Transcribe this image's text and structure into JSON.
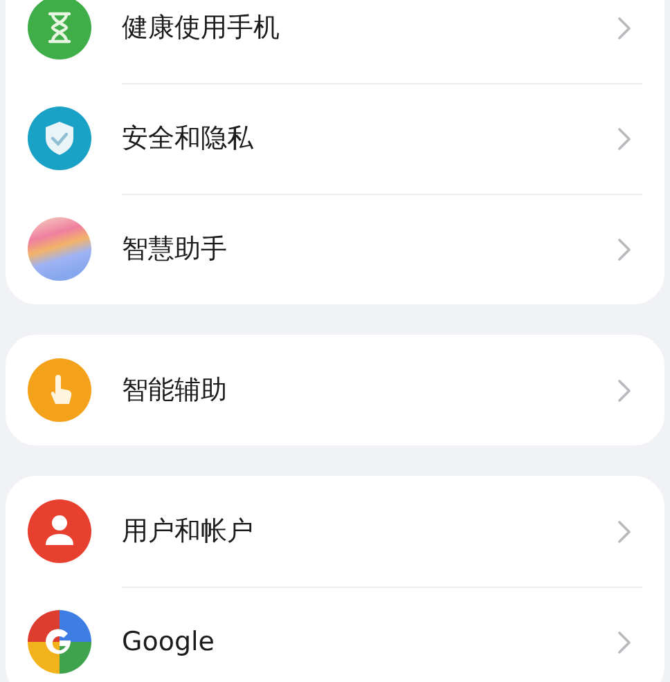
{
  "groups": [
    {
      "items": [
        {
          "label": "健康使用手机"
        },
        {
          "label": "安全和隐私"
        },
        {
          "label": "智慧助手"
        }
      ]
    },
    {
      "items": [
        {
          "label": "智能辅助"
        }
      ]
    },
    {
      "items": [
        {
          "label": "用户和帐户"
        },
        {
          "label": "Google"
        }
      ]
    }
  ]
}
